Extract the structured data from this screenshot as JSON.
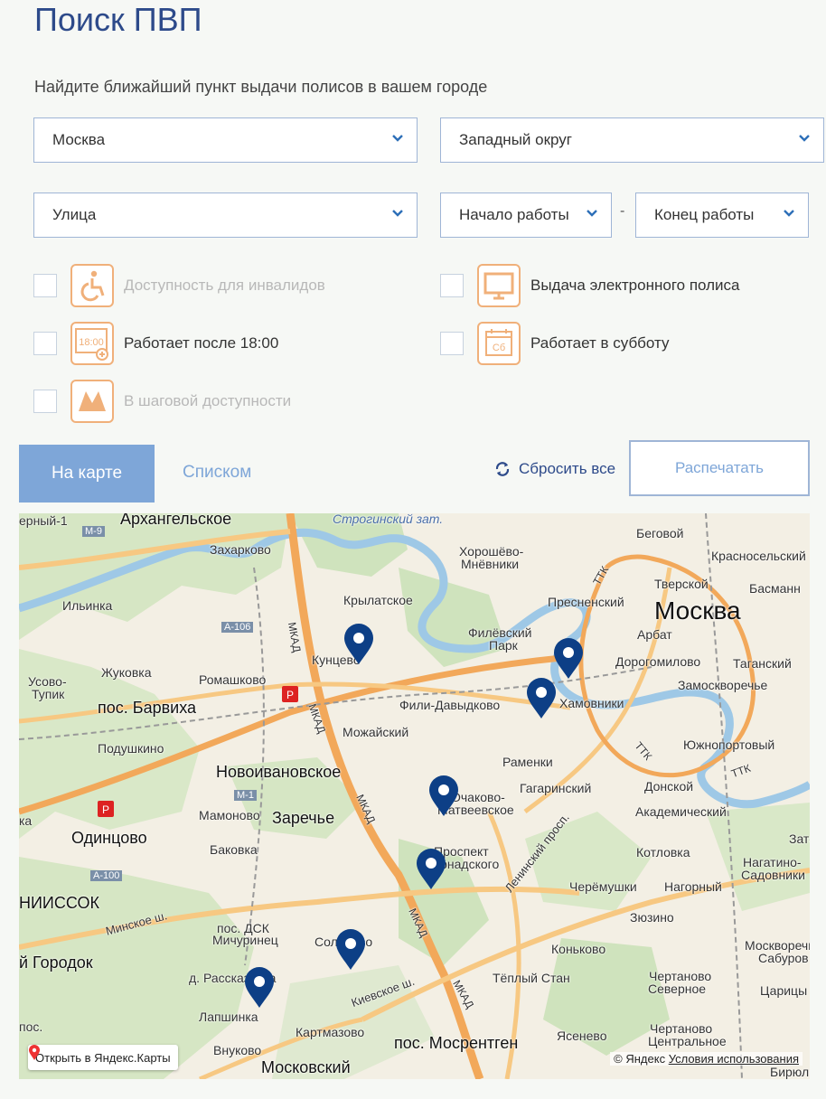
{
  "header": {
    "title": "Поиск ПВП",
    "subtitle": "Найдите ближайший пункт выдачи полисов в вашем городе"
  },
  "filters": {
    "city": "Москва",
    "district": "Западный округ",
    "street": "Улица",
    "work_start": "Начало работы",
    "work_end": "Конец работы",
    "dash": "-"
  },
  "checkboxes": {
    "disabled_access": "Доступность для инвалидов",
    "electronic_policy": "Выдача электронного полиса",
    "after_18": "Работает после 18:00",
    "saturday": "Работает в субботу",
    "walking": "В шаговой доступности"
  },
  "icons": {
    "clock_text": "18:00",
    "calendar_text": "Сб",
    "accent": "#f0b07a"
  },
  "tabs": {
    "map": "На карте",
    "list": "Списком"
  },
  "actions": {
    "reset": "Сбросить все",
    "print": "Распечатать"
  },
  "map": {
    "labels": {
      "l1": "ерный-1",
      "l2": "Архангельское",
      "l3": "Строгинский зат.",
      "l4": "Беговой",
      "l5": "Хорошёво-",
      "l5b": "Мнёвники",
      "l6": "Захарково",
      "l7": "Красносельский",
      "l8": "Тверской",
      "l9": "Крылатское",
      "l10": "Пресненский",
      "l11": "Басманн",
      "l12": "Ильинка",
      "l13": "Москва",
      "l14": "Филёвский",
      "l14b": "Парк",
      "l15": "Арбат",
      "l16": "Кунцево",
      "l17": "Дорогомилово",
      "l18": "Таганский",
      "l19": "Жуковка",
      "l20": "Ромашково",
      "l21": "Усово-",
      "l21b": "Тупик",
      "l22": "Замоскворечье",
      "l23": "Фили-Давыдково",
      "l24": "Хамовники",
      "l25": "пос. Барвиха",
      "l26": "Можайский",
      "l27": "Подушкино",
      "l28": "Южнопортовый",
      "l29": "Раменки",
      "l30": "Новоивановское",
      "l31": "Очаково-",
      "l31b": "Матвеевское",
      "l32": "Гагаринский",
      "l33": "Донской",
      "l34": "Мамоново",
      "l35": "Заречье",
      "l36": "Академический",
      "l37": "Одинцово",
      "l38": "Баковка",
      "l39": "Проспект",
      "l39b": "Вернадского",
      "l40": "Котловка",
      "l41": "Нагатино-",
      "l41b": "Садовники",
      "l42": "Черёмушки",
      "l43": "Нагорный",
      "l44": "НИИССОК",
      "l45": "Зюзино",
      "l46": "пос. ДСК",
      "l46b": "Мичуринец",
      "l47": "Солнцево",
      "l48": "Коньково",
      "l49": "Москворечье-",
      "l49b": "Сабуров",
      "l50": "й Городок",
      "l51": "д. Рассказовка",
      "l52": "Тёплый Стан",
      "l53": "Чертаново",
      "l53b": "Северное",
      "l54": "Царицы",
      "l55": "Лапшинка",
      "l56": "Картмазово",
      "l57": "Ясенево",
      "l58": "Чертаново",
      "l58b": "Центральное",
      "l59": "пос. Мосрентген",
      "l60": "Московский",
      "l61": "Бирюл",
      "l62": "Зате",
      "l63": "ка",
      "l64": "пос.",
      "l65": "Внуково",
      "road_m9": "M-9",
      "road_a106": "A-106",
      "road_m1": "M-1",
      "road_a100": "A-100",
      "mkad": "МКАД",
      "ttk": "ТТК",
      "minskoe": "Минское ш.",
      "kievskoe": "Киевское ш.",
      "leninsky": "Ленинский просп."
    },
    "open_yandex": "Открыть в Яндекс.Карты",
    "copyright": "© Яндекс",
    "terms": "Условия использования"
  }
}
